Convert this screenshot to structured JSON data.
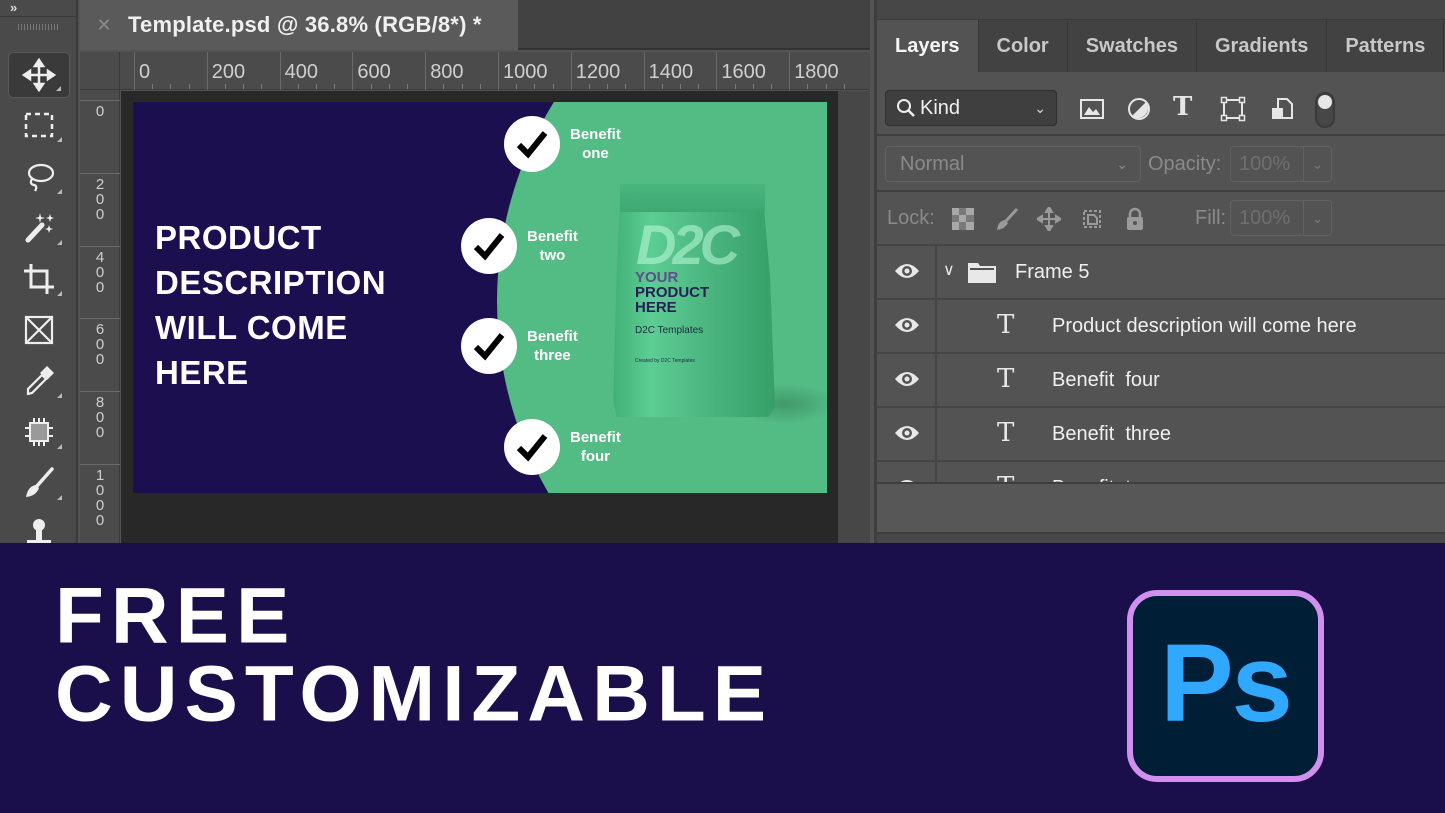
{
  "app": {
    "document_tab": {
      "title": "Template.psd @ 36.8% (RGB/8*) *",
      "close_icon": "close-icon"
    },
    "toolbar": {
      "collapse_label": "»",
      "tools": [
        {
          "name": "move-tool",
          "icon": "move-icon",
          "active": true
        },
        {
          "name": "rectangular-marquee-tool",
          "icon": "marquee-icon"
        },
        {
          "name": "lasso-tool",
          "icon": "lasso-icon"
        },
        {
          "name": "magic-wand-tool",
          "icon": "magic-wand-icon"
        },
        {
          "name": "crop-tool",
          "icon": "crop-icon"
        },
        {
          "name": "frame-tool",
          "icon": "frame-icon"
        },
        {
          "name": "eyedropper-tool",
          "icon": "eyedropper-icon"
        },
        {
          "name": "spot-healing-tool",
          "icon": "healing-icon"
        },
        {
          "name": "brush-tool",
          "icon": "brush-icon"
        },
        {
          "name": "clone-stamp-tool",
          "icon": "stamp-icon"
        }
      ]
    },
    "rulers": {
      "horizontal": [
        "0",
        "200",
        "400",
        "600",
        "800",
        "1000",
        "1200",
        "1400",
        "1600",
        "1800"
      ],
      "vertical": [
        "0",
        "200",
        "400",
        "600",
        "800",
        "1000"
      ]
    },
    "canvas": {
      "description_lines": [
        "PRODUCT",
        "DESCRIPTION",
        "WILL COME",
        "HERE"
      ],
      "benefits": [
        {
          "line1": "Benefit",
          "line2": "one"
        },
        {
          "line1": "Benefit",
          "line2": "two"
        },
        {
          "line1": "Benefit",
          "line2": "three"
        },
        {
          "line1": "Benefit",
          "line2": "four"
        }
      ],
      "bag": {
        "logo": "D2C",
        "title_lines": [
          "YOUR",
          "PRODUCT",
          "HERE"
        ],
        "brand": "D2C Templates",
        "credit": "Created by D2C Templates"
      },
      "colors": {
        "background": "#1c0f4f",
        "accent": "#53bb84"
      }
    },
    "layers_panel": {
      "tabs": [
        {
          "label": "Layers",
          "active": true
        },
        {
          "label": "Color"
        },
        {
          "label": "Swatches"
        },
        {
          "label": "Gradients"
        },
        {
          "label": "Patterns"
        }
      ],
      "filter": {
        "label": "Kind",
        "icon": "search-icon"
      },
      "filter_icons": [
        "image-filter-icon",
        "adjustment-filter-icon",
        "type-filter-icon",
        "shape-filter-icon",
        "smart-object-filter-icon"
      ],
      "blend_mode": "Normal",
      "opacity_label": "Opacity:",
      "opacity_value": "100%",
      "lock_label": "Lock:",
      "lock_icons": [
        "lock-transparent-icon",
        "lock-image-icon",
        "lock-position-icon",
        "lock-artboard-icon",
        "lock-all-icon"
      ],
      "fill_label": "Fill:",
      "fill_value": "100%",
      "layers": [
        {
          "name": "Frame 5",
          "type": "group",
          "visible": true,
          "expanded": true
        },
        {
          "name": "Product description will come here",
          "type": "text",
          "visible": true
        },
        {
          "name": "Benefit  four",
          "type": "text",
          "visible": true
        },
        {
          "name": "Benefit  three",
          "type": "text",
          "visible": true
        },
        {
          "name": "Benefit  two",
          "type": "text",
          "visible": true
        }
      ]
    }
  },
  "banner": {
    "headline_lines": [
      "FREE",
      "CUSTOMIZABLE"
    ],
    "logo_text": "Ps",
    "colors": {
      "background": "#1a0f4b",
      "logo_border": "#d18ff0",
      "logo_bg": "#001e36",
      "logo_text": "#31a8ff"
    }
  }
}
